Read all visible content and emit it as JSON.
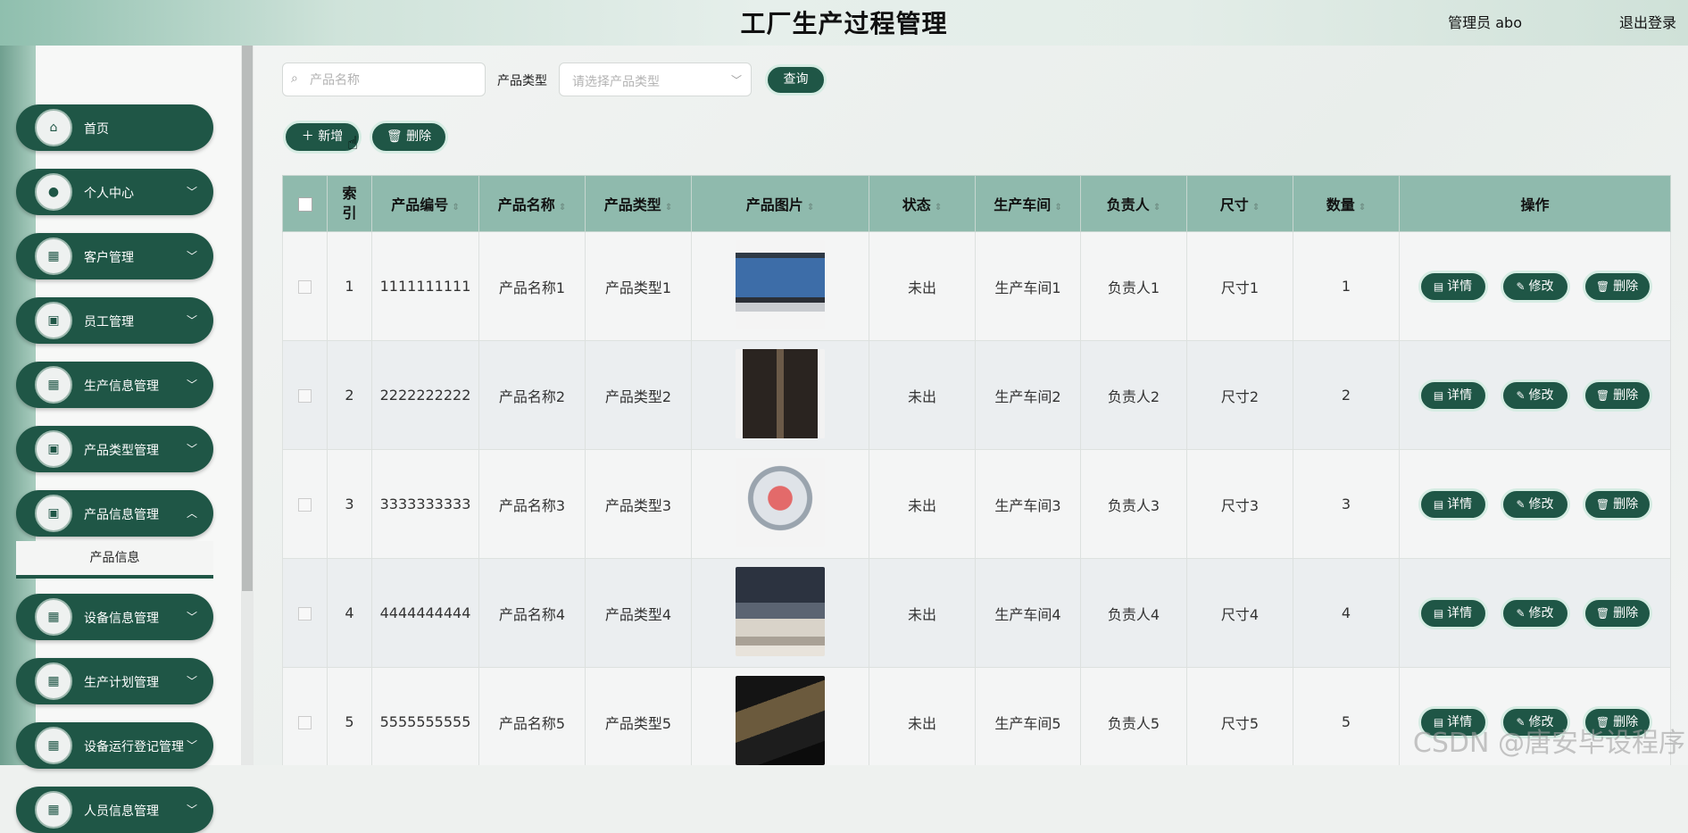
{
  "header": {
    "title": "工厂生产过程管理",
    "admin_label": "管理员 abo",
    "logout_label": "退出登录"
  },
  "sidebar": {
    "items": [
      {
        "label": "首页",
        "icon": "home-icon",
        "glyph": "⌂",
        "chevron": ""
      },
      {
        "label": "个人中心",
        "icon": "user-icon",
        "glyph": "●",
        "chevron": "﹀"
      },
      {
        "label": "客户管理",
        "icon": "grid-icon",
        "glyph": "▦",
        "chevron": "﹀"
      },
      {
        "label": "员工管理",
        "icon": "clipboard-icon",
        "glyph": "▣",
        "chevron": "﹀"
      },
      {
        "label": "生产信息管理",
        "icon": "grid-icon",
        "glyph": "▦",
        "chevron": "﹀"
      },
      {
        "label": "产品类型管理",
        "icon": "clipboard-icon",
        "glyph": "▣",
        "chevron": "﹀"
      },
      {
        "label": "产品信息管理",
        "icon": "clipboard-x-icon",
        "glyph": "▣",
        "chevron": "︿"
      },
      {
        "label": "设备信息管理",
        "icon": "grid-icon",
        "glyph": "▦",
        "chevron": "﹀"
      },
      {
        "label": "生产计划管理",
        "icon": "grid-icon",
        "glyph": "▦",
        "chevron": "﹀"
      },
      {
        "label": "设备运行登记管理",
        "icon": "grid-icon",
        "glyph": "▦",
        "chevron": "﹀"
      },
      {
        "label": "人员信息管理",
        "icon": "grid-icon",
        "glyph": "▦",
        "chevron": "﹀"
      }
    ],
    "submenu_label": "产品信息"
  },
  "toolbar": {
    "search_placeholder": "产品名称",
    "type_label": "产品类型",
    "type_placeholder": "请选择产品类型",
    "query_label": "查询",
    "add_label": "新增",
    "delete_label": "删除"
  },
  "table": {
    "headers": [
      "索引",
      "产品编号",
      "产品名称",
      "产品类型",
      "产品图片",
      "状态",
      "生产车间",
      "负责人",
      "尺寸",
      "数量",
      "操作"
    ],
    "rows": [
      {
        "index": "1",
        "code": "1111111111",
        "name": "产品名称1",
        "type": "产品类型1",
        "image": "laptop",
        "status": "未出",
        "workshop": "生产车间1",
        "owner": "负责人1",
        "size": "尺寸1",
        "qty": "1"
      },
      {
        "index": "2",
        "code": "2222222222",
        "name": "产品名称2",
        "type": "产品类型2",
        "image": "audio-system",
        "status": "未出",
        "workshop": "生产车间2",
        "owner": "负责人2",
        "size": "尺寸2",
        "qty": "2"
      },
      {
        "index": "3",
        "code": "3333333333",
        "name": "产品名称3",
        "type": "产品类型3",
        "image": "pc-case",
        "status": "未出",
        "workshop": "生产车间3",
        "owner": "负责人3",
        "size": "尺寸3",
        "qty": "3"
      },
      {
        "index": "4",
        "code": "4444444444",
        "name": "产品名称4",
        "type": "产品类型4",
        "image": "television",
        "status": "未出",
        "workshop": "生产车间4",
        "owner": "负责人4",
        "size": "尺寸4",
        "qty": "4"
      },
      {
        "index": "5",
        "code": "5555555555",
        "name": "产品名称5",
        "type": "产品类型5",
        "image": "dark-laptop",
        "status": "未出",
        "workshop": "生产车间5",
        "owner": "负责人5",
        "size": "尺寸5",
        "qty": "5"
      }
    ],
    "actions": {
      "detail": "详情",
      "edit": "修改",
      "delete": "删除"
    }
  },
  "watermark": "CSDN @唐安毕设程序",
  "colors": {
    "primary": "#1f5646",
    "header_row": "#8fbaad"
  }
}
